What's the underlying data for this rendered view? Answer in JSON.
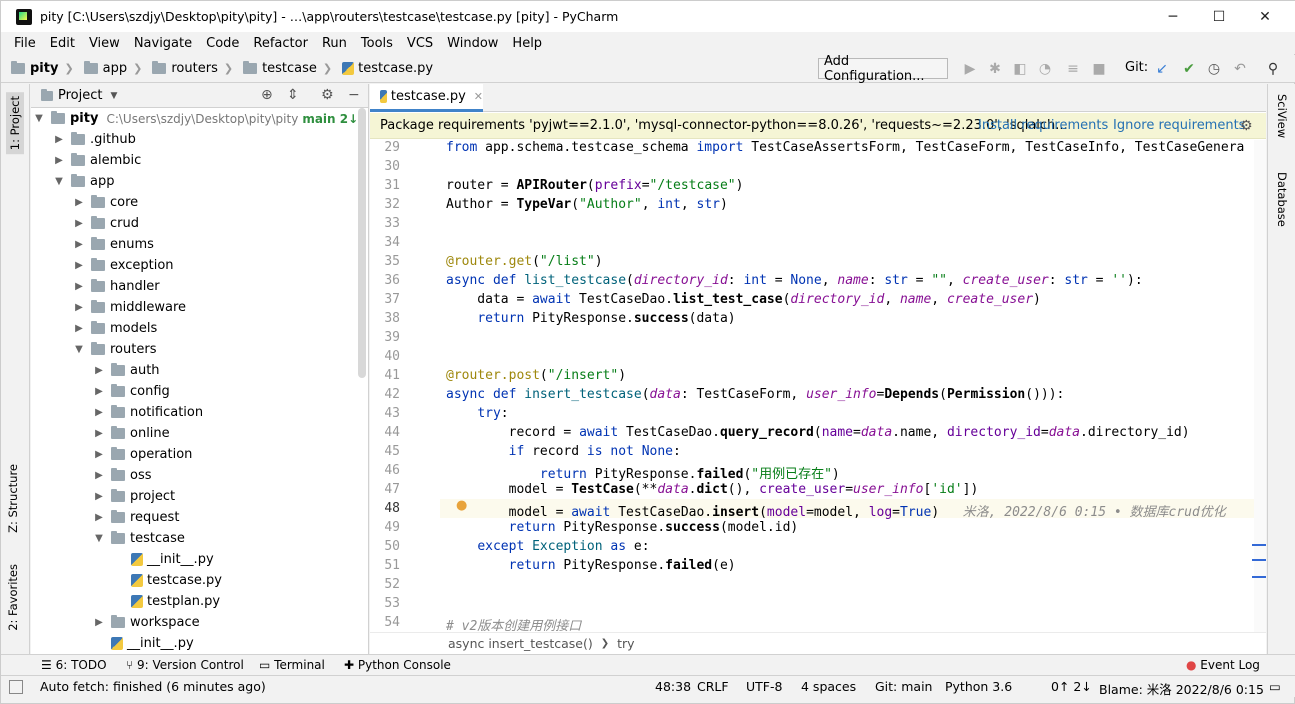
{
  "window": {
    "title": "pity [C:\\Users\\szdjy\\Desktop\\pity\\pity] - …\\app\\routers\\testcase\\testcase.py [pity] - PyCharm",
    "controls": [
      "─",
      "☐",
      "✕"
    ]
  },
  "menu": [
    "File",
    "Edit",
    "View",
    "Navigate",
    "Code",
    "Refactor",
    "Run",
    "Tools",
    "VCS",
    "Window",
    "Help"
  ],
  "navbar": {
    "crumbs": [
      "pity",
      "app",
      "routers",
      "testcase",
      "testcase.py"
    ],
    "add_configuration": "Add Configuration...",
    "git_label": "Git:"
  },
  "left_stripe": {
    "project": "1: Project",
    "structure": "Z: Structure",
    "favorites": "2: Favorites"
  },
  "right_stripe": {
    "sciview": "SciView",
    "database": "Database"
  },
  "project_panel": {
    "title": "Project",
    "root": {
      "name": "pity",
      "path": "C:\\Users\\szdjy\\Desktop\\pity\\pity",
      "branch": "main 2↓"
    },
    "items": [
      {
        "label": ".github",
        "type": "folder",
        "depth": 1,
        "expanded": false
      },
      {
        "label": "alembic",
        "type": "folder",
        "depth": 1,
        "expanded": false
      },
      {
        "label": "app",
        "type": "folder",
        "depth": 1,
        "expanded": true
      },
      {
        "label": "core",
        "type": "folder",
        "depth": 2,
        "expanded": false
      },
      {
        "label": "crud",
        "type": "folder",
        "depth": 2,
        "expanded": false
      },
      {
        "label": "enums",
        "type": "folder",
        "depth": 2,
        "expanded": false
      },
      {
        "label": "exception",
        "type": "folder",
        "depth": 2,
        "expanded": false
      },
      {
        "label": "handler",
        "type": "folder",
        "depth": 2,
        "expanded": false
      },
      {
        "label": "middleware",
        "type": "folder",
        "depth": 2,
        "expanded": false
      },
      {
        "label": "models",
        "type": "folder",
        "depth": 2,
        "expanded": false
      },
      {
        "label": "routers",
        "type": "folder",
        "depth": 2,
        "expanded": true
      },
      {
        "label": "auth",
        "type": "folder",
        "depth": 3,
        "expanded": false
      },
      {
        "label": "config",
        "type": "folder",
        "depth": 3,
        "expanded": false
      },
      {
        "label": "notification",
        "type": "folder",
        "depth": 3,
        "expanded": false
      },
      {
        "label": "online",
        "type": "folder",
        "depth": 3,
        "expanded": false
      },
      {
        "label": "operation",
        "type": "folder",
        "depth": 3,
        "expanded": false
      },
      {
        "label": "oss",
        "type": "folder",
        "depth": 3,
        "expanded": false
      },
      {
        "label": "project",
        "type": "folder",
        "depth": 3,
        "expanded": false
      },
      {
        "label": "request",
        "type": "folder",
        "depth": 3,
        "expanded": false
      },
      {
        "label": "testcase",
        "type": "folder",
        "depth": 3,
        "expanded": true
      },
      {
        "label": "__init__.py",
        "type": "file",
        "depth": 4
      },
      {
        "label": "testcase.py",
        "type": "file",
        "depth": 4
      },
      {
        "label": "testplan.py",
        "type": "file",
        "depth": 4
      },
      {
        "label": "workspace",
        "type": "folder",
        "depth": 3,
        "expanded": false
      },
      {
        "label": "__init__.py",
        "type": "file",
        "depth": 3
      }
    ]
  },
  "editor": {
    "tab": "testcase.py",
    "banner": {
      "text": "Package requirements 'pyjwt==2.1.0', 'mysql-connector-python==8.0.26', 'requests~=2.23.0', 'sqlalch...",
      "install": "Install requirements",
      "ignore": "Ignore requirements"
    },
    "line_numbers": [
      "29",
      "30",
      "31",
      "32",
      "33",
      "34",
      "35",
      "36",
      "37",
      "38",
      "39",
      "40",
      "41",
      "42",
      "43",
      "44",
      "45",
      "46",
      "47",
      "48",
      "49",
      "50",
      "51",
      "52",
      "53",
      "54"
    ],
    "inline_blame": "米洛, 2022/8/6 0:15 • 数据库crud优化",
    "breadcrumb": [
      "async insert_testcase()",
      "try"
    ]
  },
  "bottom_tools": [
    "6: TODO",
    "9: Version Control",
    "Terminal",
    "Python Console",
    "Event Log"
  ],
  "status": {
    "message": "Auto fetch: finished (6 minutes ago)",
    "position": "48:38",
    "line_sep": "CRLF",
    "encoding": "UTF-8",
    "indent": "4 spaces",
    "git": "Git: main",
    "python": "Python 3.6",
    "arrows": "0↑ 2↓",
    "blame": "Blame: 米洛 2022/8/6 0:15"
  }
}
